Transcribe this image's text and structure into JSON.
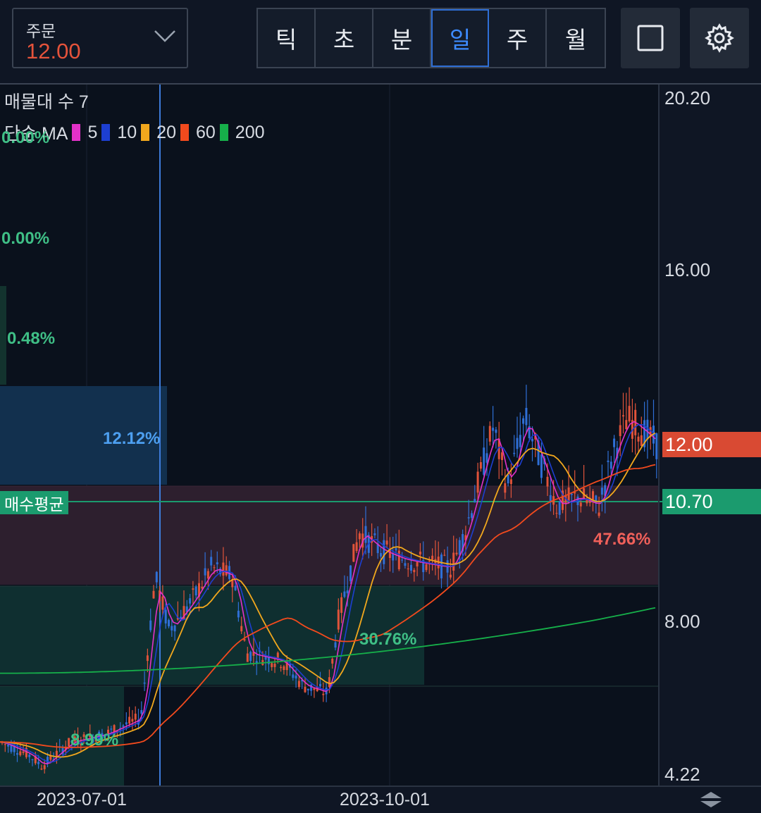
{
  "order": {
    "label": "주문",
    "value": "12.00"
  },
  "tabs": [
    {
      "label": "틱",
      "active": false
    },
    {
      "label": "초",
      "active": false
    },
    {
      "label": "분",
      "active": false
    },
    {
      "label": "일",
      "active": true
    },
    {
      "label": "주",
      "active": false
    },
    {
      "label": "월",
      "active": false
    }
  ],
  "icons": {
    "square": "square-icon",
    "settings": "gear-icon",
    "scale": "scale-arrows-icon"
  },
  "legend": {
    "volume_profile": "매물대 수 7",
    "ma_title": "단순 MA",
    "ma": [
      {
        "period": "5",
        "color": "#e331c8"
      },
      {
        "period": "10",
        "color": "#1d3fd1"
      },
      {
        "period": "20",
        "color": "#f2a81d"
      },
      {
        "period": "60",
        "color": "#f24a1d"
      },
      {
        "period": "200",
        "color": "#16b04a"
      }
    ]
  },
  "profile_pcts": [
    {
      "text": "0.00%",
      "color": "#3fbf86"
    },
    {
      "text": "0.00%",
      "color": "#3fbf86"
    },
    {
      "text": "0.48%",
      "color": "#3fbf86"
    },
    {
      "text": "12.12%",
      "color": "#4d9ff0"
    },
    {
      "text": "47.66%",
      "color": "#f0605a"
    },
    {
      "text": "30.76%",
      "color": "#3fbf86"
    },
    {
      "text": "8.99%",
      "color": "#3fbf86"
    }
  ],
  "price_axis": [
    "20.20",
    "16.00",
    "8.00",
    "4.22"
  ],
  "current_price": {
    "value": "12.00",
    "color": "#d94a33"
  },
  "avg_price": {
    "label": "매수평균",
    "value": "10.70",
    "color": "#1b9b6e"
  },
  "dates": [
    "2023-07-01",
    "2023-10-01"
  ],
  "chart_data": {
    "type": "candlestick",
    "y_axis": {
      "min": 4.22,
      "max": 20.2,
      "ticks": [
        20.2,
        16.0,
        8.0,
        4.22
      ]
    },
    "x_labels": [
      "2023-07-01",
      "2023-10-01"
    ],
    "last_close": 12.0,
    "average_buy_price": 10.7,
    "moving_averages": [
      "5",
      "10",
      "20",
      "60",
      "200"
    ],
    "volume_profile_buckets": 7
  }
}
